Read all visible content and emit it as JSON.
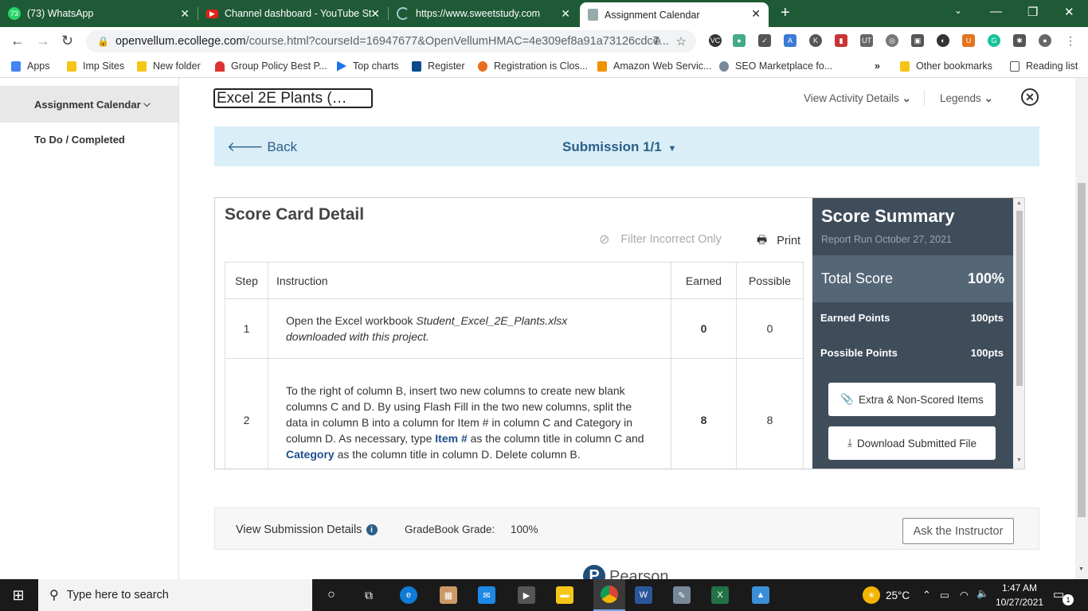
{
  "browser": {
    "tabs": [
      {
        "label": "(73) WhatsApp",
        "badge": "73"
      },
      {
        "label": "Channel dashboard - YouTube St"
      },
      {
        "label": "https://www.sweetstudy.com"
      },
      {
        "label": "Assignment Calendar"
      }
    ],
    "url_host": "openvellum.ecollege.com",
    "url_rest": "/course.html?courseId=16947677&OpenVellumHMAC=4e309ef8a91a73126cdc7...",
    "bookmarks": [
      "Apps",
      "Imp Sites",
      "New folder",
      "Group Policy Best P...",
      "Top charts",
      "Register",
      "Registration is Clos...",
      "Amazon Web Servic...",
      "SEO Marketplace fo..."
    ],
    "bookmarks_overflow": "»",
    "other_bookmarks": "Other bookmarks",
    "reading_list": "Reading list"
  },
  "sidebar": {
    "assignment_calendar": "Assignment Calendar",
    "todo": "To Do / Completed"
  },
  "header": {
    "assignment_title": "Excel 2E Plants (…",
    "view_activity": "View Activity Details",
    "legends": "Legends"
  },
  "submission_bar": {
    "back": "Back",
    "submission": "Submission 1/1"
  },
  "scorecard": {
    "title": "Score Card Detail",
    "filter": "Filter Incorrect Only",
    "print": "Print",
    "columns": {
      "step": "Step",
      "instruction": "Instruction",
      "earned": "Earned",
      "possible": "Possible"
    },
    "rows": [
      {
        "step": "1",
        "earned": "0",
        "possible": "0",
        "ins_a": "Open the Excel workbook ",
        "ins_file": "Student_Excel_2E_Plants.xlsx",
        "ins_b": "downloaded with this project."
      },
      {
        "step": "2",
        "earned": "8",
        "possible": "8",
        "ins_a": "To the right of column B, insert two new columns to create new blank columns C and D. By using Flash Fill in the two new columns, split the data in column B into a column for Item # in column C and Category in column D. As necessary, type ",
        "ins_item": "Item #",
        "ins_mid": " as the column title in column C and ",
        "ins_cat": "Category",
        "ins_end": " as the column title in column D. Delete column B."
      }
    ]
  },
  "summary": {
    "title": "Score Summary",
    "report_run": "Report Run October 27, 2021",
    "total_label": "Total Score",
    "total_value": "100%",
    "earned_label": "Earned Points",
    "earned_value": "100pts",
    "possible_label": "Possible Points",
    "possible_value": "100pts",
    "extra_btn": "Extra & Non-Scored Items",
    "download_btn": "Download Submitted File"
  },
  "footer": {
    "view_details": "View Submission Details",
    "gradebook_label": "GradeBook Grade:",
    "gradebook_value": "100%",
    "ask": "Ask the Instructor",
    "brand": "Pearson"
  },
  "taskbar": {
    "search_placeholder": "Type here to search",
    "temperature": "25°C",
    "time": "1:47 AM",
    "date": "10/27/2021",
    "notifications": "1"
  },
  "colors": {
    "chrome_green": "#1e5a35",
    "accent_blue": "#2b5f8a",
    "summary_bg": "#3f4d5b"
  }
}
